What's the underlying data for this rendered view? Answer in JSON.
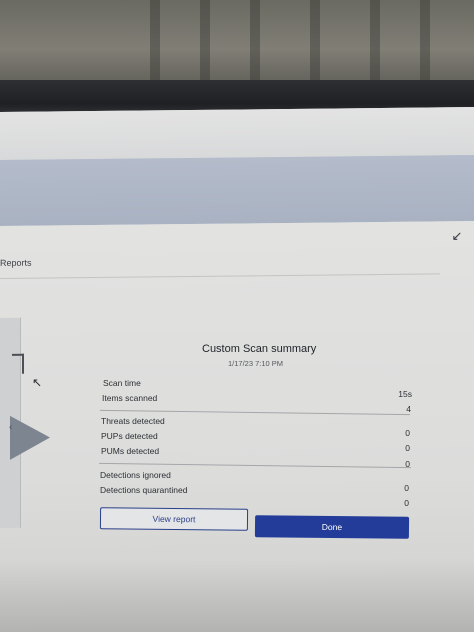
{
  "app": {
    "tab_label": "Reports",
    "collapse_icon": "collapse-arrow-icon"
  },
  "summary": {
    "title": "Custom Scan summary",
    "datetime": "1/17/23 7:10 PM",
    "rows": {
      "scan_time": {
        "label": "Scan time",
        "value": "15s"
      },
      "items_scanned": {
        "label": "Items scanned",
        "value": "4"
      },
      "threats_detected": {
        "label": "Threats detected",
        "value": "0"
      },
      "pups_detected": {
        "label": "PUPs detected",
        "value": "0"
      },
      "pums_detected": {
        "label": "PUMs detected",
        "value": "0"
      },
      "detections_ignored": {
        "label": "Detections ignored",
        "value": "0"
      },
      "detections_quarantined": {
        "label": "Detections quarantined",
        "value": "0"
      }
    }
  },
  "buttons": {
    "view_report": "View report",
    "done": "Done"
  },
  "colors": {
    "accent": "#233c9a",
    "header_band": "#b4bccb"
  }
}
